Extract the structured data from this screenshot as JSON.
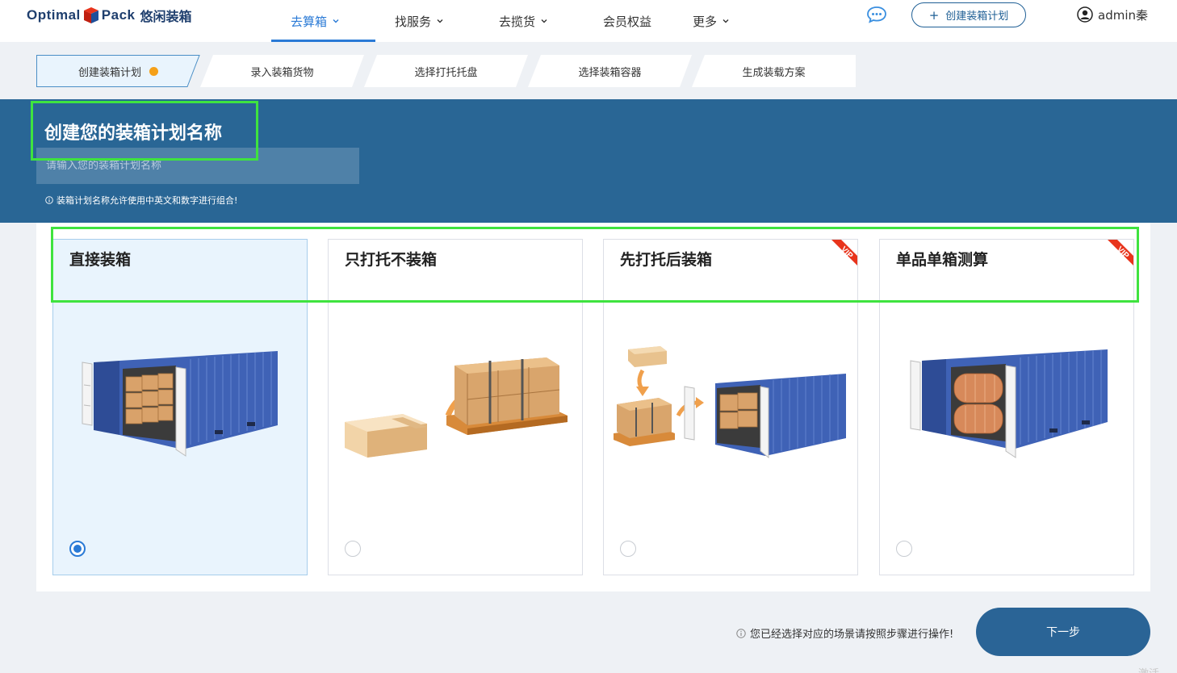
{
  "brand": {
    "word1": "Optimal",
    "word2": "Pack",
    "cn_name": "悠闲装箱"
  },
  "nav": {
    "items": [
      {
        "label": "去算箱",
        "has_dropdown": true,
        "active": true
      },
      {
        "label": "找服务",
        "has_dropdown": true
      },
      {
        "label": "去揽货",
        "has_dropdown": true
      },
      {
        "label": "会员权益",
        "has_dropdown": false
      },
      {
        "label": "更多",
        "has_dropdown": true
      }
    ],
    "create_plan_label": "创建装箱计划",
    "user_name": "admin秦"
  },
  "steps": [
    {
      "label": "创建装箱计划",
      "active": true
    },
    {
      "label": "录入装箱货物"
    },
    {
      "label": "选择打托托盘"
    },
    {
      "label": "选择装箱容器"
    },
    {
      "label": "生成装载方案"
    }
  ],
  "banner": {
    "title": "创建您的装箱计划名称",
    "input_placeholder": "请输入您的装箱计划名称",
    "input_value": "",
    "hint": "装箱计划名称允许使用中英文和数字进行组合!"
  },
  "options": [
    {
      "title": "直接装箱",
      "selected": true,
      "vip": false,
      "icon": "container-with-boxes-icon"
    },
    {
      "title": "只打托不装箱",
      "selected": false,
      "vip": false,
      "icon": "box-to-pallet-icon"
    },
    {
      "title": "先打托后装箱",
      "selected": false,
      "vip": true,
      "icon": "pallet-to-container-icon"
    },
    {
      "title": "单品单箱测算",
      "selected": false,
      "vip": true,
      "icon": "container-with-rolls-icon"
    }
  ],
  "vip_label": "VIP",
  "footer": {
    "hint": "您已经选择对应的场景请按照步骤进行操作!",
    "next_label": "下一步",
    "corner_text": "激活"
  },
  "colors": {
    "primary": "#2a7ad6",
    "banner": "#296695",
    "next_button": "#2a6496",
    "highlight": "#3fe33f",
    "step_dot": "#f5a018",
    "vip": "#e8341c"
  }
}
